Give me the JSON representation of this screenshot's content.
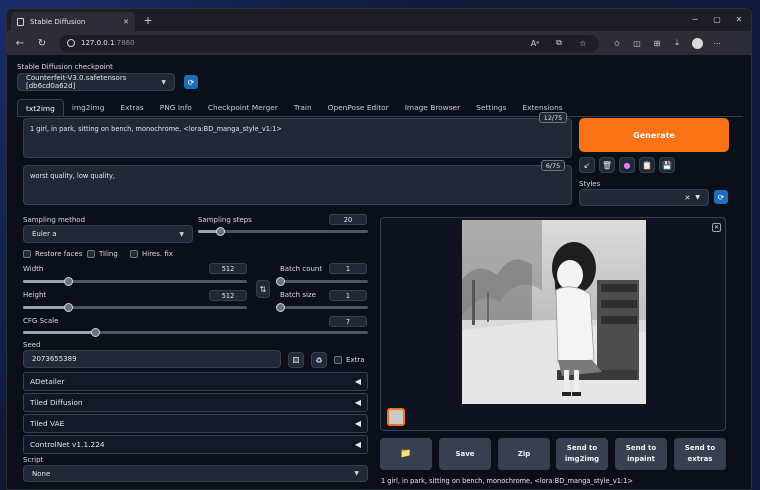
{
  "browser": {
    "tab_title": "Stable Diffusion",
    "new_tab": "+",
    "url_host": "127.0.0.1",
    "url_port": ":7860",
    "window_controls": [
      "minimize-icon",
      "maximize-icon",
      "close-icon"
    ]
  },
  "checkpoint": {
    "label": "Stable Diffusion checkpoint",
    "value": "Counterfeit-V3.0.safetensors [db6cd0a62d]"
  },
  "tabs": [
    "txt2img",
    "img2img",
    "Extras",
    "PNG Info",
    "Checkpoint Merger",
    "Train",
    "OpenPose Editor",
    "Image Browser",
    "Settings",
    "Extensions"
  ],
  "prompt": {
    "text": "1 girl, in park, sitting on bench,  monochrome, <lora:BD_manga_style_v1:1>",
    "counter": "12/75"
  },
  "negative_prompt": {
    "text": "worst quality,  low quality,",
    "counter": "6/75"
  },
  "generate_label": "Generate",
  "styles": {
    "label": "Styles",
    "clear": "✕"
  },
  "sampling": {
    "method_label": "Sampling method",
    "method_value": "Euler a",
    "steps_label": "Sampling steps",
    "steps_value": "20",
    "steps_fraction": 0.13
  },
  "checks": {
    "restore_faces": "Restore faces",
    "tiling": "Tiling",
    "hires_fix": "Hires. fix",
    "extra": "Extra"
  },
  "dimensions": {
    "width_label": "Width",
    "width_value": "512",
    "width_fraction": 0.2,
    "height_label": "Height",
    "height_value": "512",
    "height_fraction": 0.2,
    "swap": "⇅"
  },
  "batch": {
    "count_label": "Batch count",
    "count_value": "1",
    "count_fraction": 0.0,
    "size_label": "Batch size",
    "size_value": "1",
    "size_fraction": 0.0
  },
  "cfg": {
    "label": "CFG Scale",
    "value": "7",
    "fraction": 0.21
  },
  "seed": {
    "label": "Seed",
    "value": "2073655389"
  },
  "accordions": [
    "ADetailer",
    "Tiled Diffusion",
    "Tiled VAE",
    "ControlNet v1.1.224"
  ],
  "script": {
    "label": "Script",
    "value": "None"
  },
  "output_buttons": {
    "folder": "📁",
    "save": "Save",
    "zip": "Zip",
    "send_img2img": [
      "Send to",
      "img2img"
    ],
    "send_inpaint": [
      "Send to",
      "inpaint"
    ],
    "send_extras": [
      "Send to",
      "extras"
    ]
  },
  "output_caption": "1 girl, in park, sitting on bench, monochrome, <lora:BD_manga_style_v1:1>",
  "colors": {
    "accent": "#f97316",
    "background": "#0b0f19",
    "panel": "#111827",
    "input": "#1f2937",
    "blue_button": "#1d6fb8"
  }
}
